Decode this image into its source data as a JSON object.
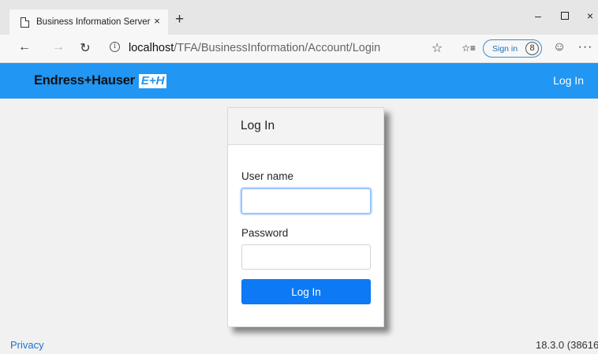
{
  "browser": {
    "tab_title": "Business Information Server",
    "tab_close": "×",
    "new_tab": "+",
    "window_min": "–",
    "window_close": "×",
    "url_host": "localhost",
    "url_path": "/TFA/BusinessInformation/Account/Login",
    "signin_label": "Sign in",
    "icons": {
      "back": "←",
      "forward": "→",
      "refresh": "↻",
      "info": "i",
      "star": "☆",
      "favorites": "☆≡",
      "person": "8",
      "smile": "☺",
      "more": "···"
    }
  },
  "navbar": {
    "brand_text": "Endress+Hauser",
    "brand_logo_text": "E+H",
    "login_link": "Log In",
    "color": "#2196f3"
  },
  "login_card": {
    "title": "Log In",
    "username_label": "User name",
    "username_value": "",
    "password_label": "Password",
    "password_value": "",
    "submit_label": "Log In",
    "accent": "#0d79f5"
  },
  "footer": {
    "privacy_link": "Privacy",
    "version": "18.3.0 (38616"
  }
}
